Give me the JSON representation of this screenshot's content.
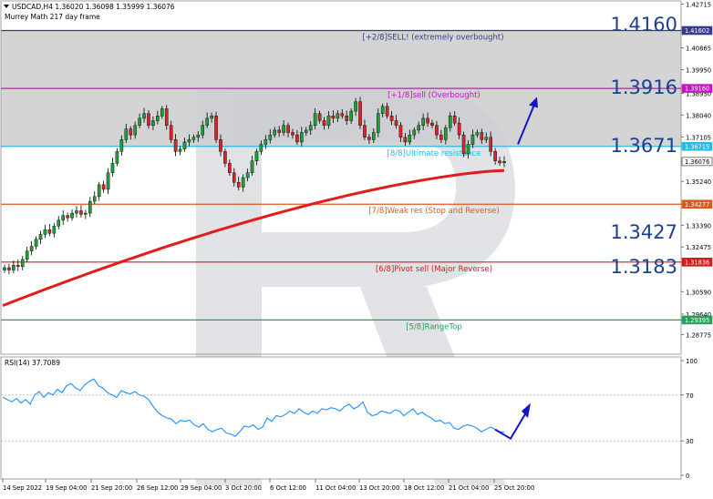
{
  "header": {
    "symbol_line": "USDCAD,H4  1.36020 1.36098 1.35999 1.36076",
    "indicator_name": "Murrey Math 217 day frame"
  },
  "rsi": {
    "label": "RSI(14) 37.7089",
    "ticks": [
      "100",
      "70",
      "30",
      "0"
    ],
    "last_value": 37.7089
  },
  "big_labels": [
    "1.4160",
    "1.3916",
    "1.3671",
    "1.3427",
    "1.3183"
  ],
  "colors": {
    "ma": "#e41b1b",
    "rsi": "#1e90ff",
    "bull": "#1f9e3a",
    "bear": "#d7262a",
    "arrow": "#1414c8",
    "zone": "#d4d4d4",
    "big_label": "#1d3f8e"
  },
  "chart_data": {
    "type": "candlestick",
    "symbol": "USDCAD",
    "timeframe": "H4",
    "ohlc_last": {
      "open": 1.3602,
      "high": 1.36098,
      "low": 1.35999,
      "close": 1.36076
    },
    "y_range": [
      1.2795,
      1.4285
    ],
    "y_ticks": [
      "1.42715",
      "1.41602",
      "1.40865",
      "1.39950",
      "1.38950",
      "1.38040",
      "1.37105",
      "1.36076",
      "1.35240",
      "1.34277",
      "1.33390",
      "1.32475",
      "1.31836",
      "1.30590",
      "1.29640",
      "1.29395",
      "1.28775"
    ],
    "x_ticks": [
      "14 Sep 2022",
      "19 Sep 04:00",
      "21 Sep 20:00",
      "26 Sep 12:00",
      "29 Sep 04:00",
      "3 Oct 20:00",
      "6 Oct 12:00",
      "11 Oct 04:00",
      "13 Oct 20:00",
      "18 Oct 12:00",
      "21 Oct 04:00",
      "25 Oct 20:00"
    ],
    "highlight_ticks": [
      {
        "value": 1.41602,
        "label": "1.41602",
        "color": "#3a3a8c"
      },
      {
        "value": 1.3916,
        "label": "1.39160",
        "color": "#c316c3"
      },
      {
        "value": 1.36715,
        "label": "1.36715",
        "color": "#2bb9e6"
      },
      {
        "value": 1.36076,
        "label": "1.36076",
        "color": "#222222",
        "current": true
      },
      {
        "value": 1.34277,
        "label": "1.34277",
        "color": "#e0571f"
      },
      {
        "value": 1.31836,
        "label": "1.31836",
        "color": "#d61a1a"
      },
      {
        "value": 1.29395,
        "label": "1.29395",
        "color": "#2a9e5a"
      }
    ],
    "murrey_levels": [
      {
        "value": 1.41602,
        "label": "[+2/8]SELL! (extremely overbought)",
        "color": "#3a3a8c"
      },
      {
        "value": 1.3916,
        "label": "[+1/8]sell (Overbought)",
        "color": "#c316c3"
      },
      {
        "value": 1.36715,
        "label": "[8/8]Ultimate resistance",
        "color": "#2bb9e6"
      },
      {
        "value": 1.34277,
        "label": "[7/8]Weak res (Stop and Reverse)",
        "color": "#e0571f"
      },
      {
        "value": 1.31836,
        "label": "[6/8]Pivot sell (Major Reverse)",
        "color": "#d61a1a"
      },
      {
        "value": 1.29395,
        "label": "[5/8]RangeTop",
        "color": "#2a9e5a"
      }
    ],
    "closes": [
      1.316,
      1.315,
      1.317,
      1.3165,
      1.3195,
      1.323,
      1.325,
      1.328,
      1.33,
      1.332,
      1.3305,
      1.3335,
      1.336,
      1.338,
      1.337,
      1.339,
      1.34,
      1.3385,
      1.339,
      1.344,
      1.346,
      1.351,
      1.349,
      1.356,
      1.36,
      1.365,
      1.37,
      1.3745,
      1.372,
      1.376,
      1.379,
      1.381,
      1.376,
      1.378,
      1.38,
      1.383,
      1.376,
      1.37,
      1.365,
      1.366,
      1.369,
      1.37,
      1.371,
      1.372,
      1.376,
      1.379,
      1.38,
      1.37,
      1.365,
      1.36,
      1.356,
      1.352,
      1.35,
      1.354,
      1.356,
      1.361,
      1.365,
      1.368,
      1.37,
      1.372,
      1.374,
      1.373,
      1.376,
      1.373,
      1.372,
      1.369,
      1.373,
      1.374,
      1.376,
      1.381,
      1.378,
      1.376,
      1.38,
      1.379,
      1.381,
      1.38,
      1.378,
      1.382,
      1.386,
      1.376,
      1.371,
      1.37,
      1.373,
      1.381,
      1.384,
      1.38,
      1.378,
      1.376,
      1.371,
      1.369,
      1.372,
      1.374,
      1.376,
      1.379,
      1.377,
      1.376,
      1.372,
      1.37,
      1.375,
      1.38,
      1.377,
      1.372,
      1.364,
      1.368,
      1.372,
      1.373,
      1.37,
      1.371,
      1.365,
      1.361,
      1.3602,
      1.3608
    ],
    "ma_start": 1.3,
    "ma_end": 1.357,
    "arrow": {
      "from": 1.368,
      "to": 1.388
    },
    "rsi_values": [
      68,
      66,
      64,
      67,
      63,
      66,
      62,
      70,
      73,
      68,
      72,
      70,
      75,
      72,
      78,
      80,
      76,
      74,
      79,
      82,
      84,
      78,
      76,
      72,
      70,
      68,
      74,
      72,
      71,
      73,
      70,
      69,
      66,
      60,
      55,
      52,
      50,
      49,
      45,
      48,
      47,
      48,
      44,
      42,
      45,
      40,
      38,
      40,
      41,
      37,
      36,
      34,
      38,
      43,
      42,
      44,
      40,
      42,
      50,
      47,
      52,
      51,
      53,
      56,
      54,
      58,
      55,
      53,
      56,
      54,
      58,
      57,
      59,
      58,
      56,
      60,
      62,
      58,
      60,
      64,
      55,
      52,
      53,
      56,
      55,
      54,
      57,
      56,
      52,
      55,
      58,
      53,
      55,
      52,
      50,
      47,
      48,
      45,
      46,
      41,
      40,
      43,
      44,
      43,
      41,
      38,
      40,
      42,
      40,
      38,
      37.7
    ]
  }
}
